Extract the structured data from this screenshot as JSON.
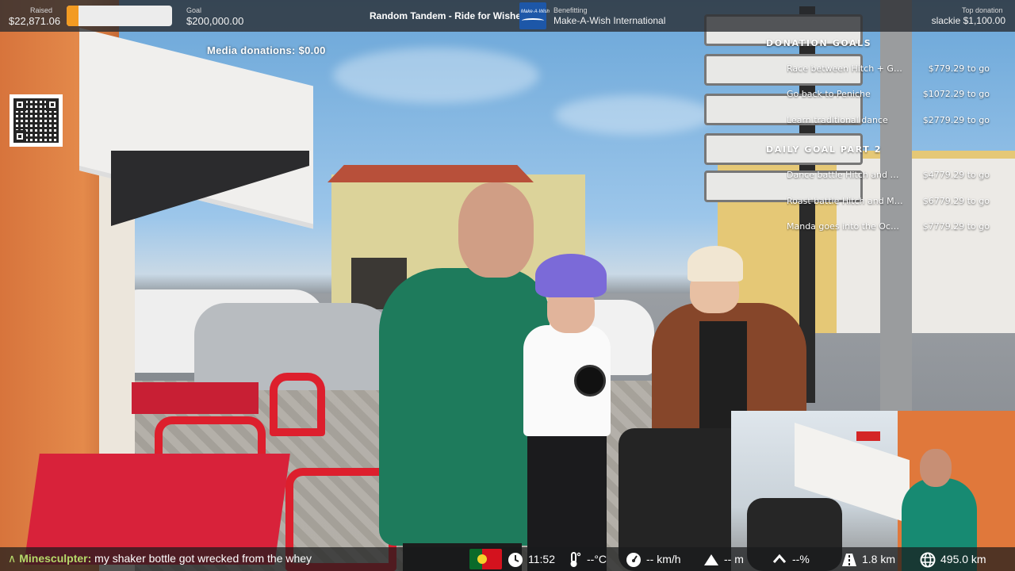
{
  "topbar": {
    "raised_label": "Raised",
    "raised_value": "$22,871.06",
    "progress_fraction": 0.114,
    "goal_label": "Goal",
    "goal_value": "$200,000.00",
    "stream_title": "Random Tandem - Ride for Wishes",
    "charity_logo_text": "Make·A·Wish",
    "benefitting_label": "Benefitting",
    "benefitting_value": "Make-A-Wish International",
    "top_donation_label": "Top donation",
    "top_donation_value": "slackie $1,100.00"
  },
  "media_donations": "Media donations: $0.00",
  "goals": {
    "section1_title": "DONATION GOALS",
    "section1_items": [
      {
        "name": "Race between Hitch + Guest",
        "amount": "$779.29 to go"
      },
      {
        "name": "Go back to Peniche",
        "amount": "$1072.29 to go"
      },
      {
        "name": "Learn traditional dance",
        "amount": "$2779.29 to go"
      }
    ],
    "section2_title": "DAILY GOAL PART 2",
    "section2_items": [
      {
        "name": "Dance battle Hitch and Man...",
        "amount": "$4779.29 to go"
      },
      {
        "name": "Roast battle Hitch and Manda",
        "amount": "$6779.29 to go"
      },
      {
        "name": "Manda goes into the Ocean",
        "amount": "$7779.29 to go"
      }
    ]
  },
  "chat": {
    "chevron": "∧",
    "user": "Minesculpter:",
    "message": "my shaker bottle got wrecked from the whey"
  },
  "status": {
    "time": "11:52",
    "temperature": "--°C",
    "speed": "-- km/h",
    "elevation": "-- m",
    "grade": "--%",
    "distance_today": "1.8 km",
    "distance_total": "495.0 km"
  },
  "icons": {
    "clock": "clock-icon",
    "thermometer": "thermometer-icon",
    "speedometer": "speedometer-icon",
    "elevation": "mountain-icon",
    "grade": "chevron-up-icon",
    "distance": "road-icon",
    "globe": "globe-icon"
  },
  "colors": {
    "progress_fill": "#f39b22",
    "chat_user": "#b6d96a"
  }
}
